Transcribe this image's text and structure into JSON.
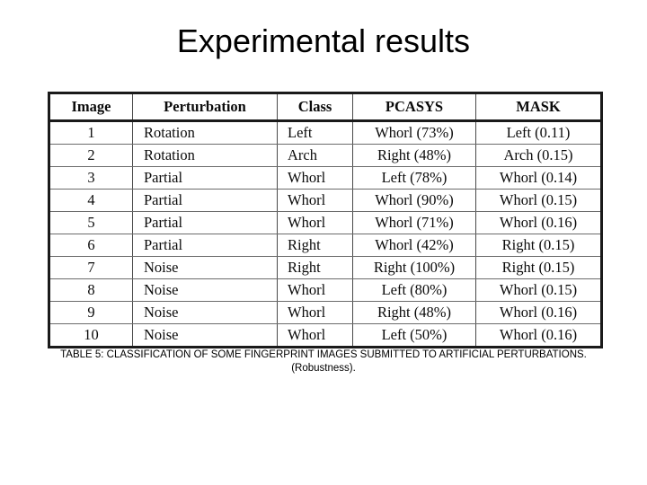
{
  "slide": {
    "title": "Experimental results",
    "background_color": "#ffffff",
    "text_color": "#000000"
  },
  "table": {
    "columns": [
      "Image",
      "Perturbation",
      "Class",
      "PCASYS",
      "MASK"
    ],
    "rows": [
      {
        "image": "1",
        "perturbation": "Rotation",
        "class": "Left",
        "pcasys": "Whorl (73%)",
        "mask": "Left (0.11)"
      },
      {
        "image": "2",
        "perturbation": "Rotation",
        "class": "Arch",
        "pcasys": "Right (48%)",
        "mask": "Arch (0.15)"
      },
      {
        "image": "3",
        "perturbation": "Partial",
        "class": "Whorl",
        "pcasys": "Left (78%)",
        "mask": "Whorl (0.14)"
      },
      {
        "image": "4",
        "perturbation": "Partial",
        "class": "Whorl",
        "pcasys": "Whorl (90%)",
        "mask": "Whorl (0.15)"
      },
      {
        "image": "5",
        "perturbation": "Partial",
        "class": "Whorl",
        "pcasys": "Whorl (71%)",
        "mask": "Whorl (0.16)"
      },
      {
        "image": "6",
        "perturbation": "Partial",
        "class": "Right",
        "pcasys": "Whorl (42%)",
        "mask": "Right (0.15)"
      },
      {
        "image": "7",
        "perturbation": "Noise",
        "class": "Right",
        "pcasys": "Right (100%)",
        "mask": "Right (0.15)"
      },
      {
        "image": "8",
        "perturbation": "Noise",
        "class": "Whorl",
        "pcasys": "Left (80%)",
        "mask": "Whorl (0.15)"
      },
      {
        "image": "9",
        "perturbation": "Noise",
        "class": "Whorl",
        "pcasys": "Right (48%)",
        "mask": "Whorl (0.16)"
      },
      {
        "image": "10",
        "perturbation": "Noise",
        "class": "Whorl",
        "pcasys": "Left (50%)",
        "mask": "Whorl (0.16)"
      }
    ]
  },
  "caption": {
    "text": "TABLE 5: CLASSIFICATION OF SOME FINGERPRINT IMAGES SUBMITTED TO ARTIFICIAL PERTURBATIONS. (Robustness)."
  }
}
